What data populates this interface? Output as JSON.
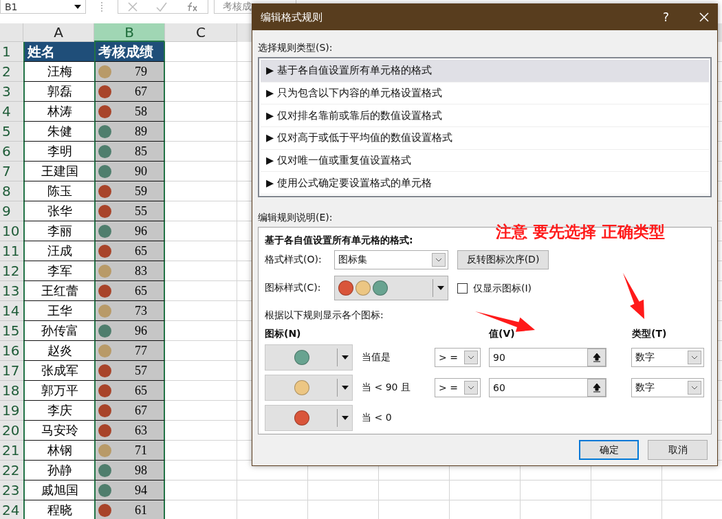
{
  "formula_bar": {
    "name_box": "B1",
    "formula": "考核成"
  },
  "columns": [
    {
      "label": "A",
      "selected": false
    },
    {
      "label": "B",
      "selected": true
    },
    {
      "label": "C",
      "selected": false
    }
  ],
  "header_row": {
    "row": "1",
    "cells": [
      "姓名",
      "考核成绩"
    ]
  },
  "rows": [
    {
      "row": "2",
      "name": "汪梅",
      "score": "79",
      "color": "#b89a68"
    },
    {
      "row": "3",
      "name": "郭磊",
      "score": "67",
      "color": "#a8442a"
    },
    {
      "row": "4",
      "name": "林涛",
      "score": "58",
      "color": "#a8442a"
    },
    {
      "row": "5",
      "name": "朱健",
      "score": "89",
      "color": "#4f7e6d"
    },
    {
      "row": "6",
      "name": "李明",
      "score": "85",
      "color": "#4f7e6d"
    },
    {
      "row": "7",
      "name": "王建国",
      "score": "90",
      "color": "#4f7e6d"
    },
    {
      "row": "8",
      "name": "陈玉",
      "score": "59",
      "color": "#a8442a"
    },
    {
      "row": "9",
      "name": "张华",
      "score": "55",
      "color": "#a8442a"
    },
    {
      "row": "10",
      "name": "李丽",
      "score": "96",
      "color": "#4f7e6d"
    },
    {
      "row": "11",
      "name": "汪成",
      "score": "65",
      "color": "#a8442a"
    },
    {
      "row": "12",
      "name": "李军",
      "score": "83",
      "color": "#b89a68"
    },
    {
      "row": "13",
      "name": "王红蕾",
      "score": "65",
      "color": "#a8442a"
    },
    {
      "row": "14",
      "name": "王华",
      "score": "73",
      "color": "#b89a68"
    },
    {
      "row": "15",
      "name": "孙传富",
      "score": "96",
      "color": "#4f7e6d"
    },
    {
      "row": "16",
      "name": "赵炎",
      "score": "77",
      "color": "#b89a68"
    },
    {
      "row": "17",
      "name": "张成军",
      "score": "57",
      "color": "#a8442a"
    },
    {
      "row": "18",
      "name": "郭万平",
      "score": "65",
      "color": "#a8442a"
    },
    {
      "row": "19",
      "name": "李庆",
      "score": "67",
      "color": "#a8442a"
    },
    {
      "row": "20",
      "name": "马安玲",
      "score": "63",
      "color": "#a8442a"
    },
    {
      "row": "21",
      "name": "林钢",
      "score": "71",
      "color": "#b89a68"
    },
    {
      "row": "22",
      "name": "孙静",
      "score": "98",
      "color": "#4f7e6d"
    },
    {
      "row": "23",
      "name": "戚旭国",
      "score": "94",
      "color": "#4f7e6d"
    },
    {
      "row": "24",
      "name": "程晓",
      "score": "61",
      "color": "#a8442a"
    }
  ],
  "dialog": {
    "title": "编辑格式规则",
    "help": "?",
    "rule_type_label": "选择规则类型(S):",
    "rule_types": [
      {
        "label": "▶ 基于各自值设置所有单元格的格式",
        "selected": true
      },
      {
        "label": "▶ 只为包含以下内容的单元格设置格式",
        "selected": false
      },
      {
        "label": "▶ 仅对排名靠前或靠后的数值设置格式",
        "selected": false
      },
      {
        "label": "▶ 仅对高于或低于平均值的数值设置格式",
        "selected": false
      },
      {
        "label": "▶ 仅对唯一值或重复值设置格式",
        "selected": false
      },
      {
        "label": "▶ 使用公式确定要设置格式的单元格",
        "selected": false
      }
    ],
    "description_label": "编辑规则说明(E):",
    "description": {
      "heading": "基于各自值设置所有单元格的格式:",
      "format_style": {
        "label": "格式样式(O):",
        "value": "图标集"
      },
      "reverse_button": "反转图标次序(D)",
      "icon_style": {
        "label": "图标样式(C):",
        "colors": [
          {
            "color": "#d9553a"
          },
          {
            "color": "#ecc683"
          },
          {
            "color": "#68a390"
          }
        ]
      },
      "show_icon_only": {
        "label": "仅显示图标(I)",
        "checked": false
      },
      "rules_label": "根据以下规则显示各个图标:",
      "headers": {
        "icon": "图标(N)",
        "value": "值(V)",
        "type": "类型(T)"
      },
      "rules": [
        {
          "kind": "threshold",
          "color": "#68a390",
          "condition": "当值是",
          "operator": "> =",
          "value": "90",
          "type": "数字"
        },
        {
          "kind": "threshold",
          "color": "#ecc683",
          "condition": "当 < 90 且",
          "operator": "> =",
          "value": "60",
          "type": "数字"
        },
        {
          "kind": "last",
          "color": "#d9553a",
          "condition": "当 < 0"
        }
      ]
    },
    "buttons": [
      {
        "label": "确定",
        "default": true
      },
      {
        "label": "取消",
        "default": false
      }
    ]
  },
  "annotation": "注意 要先选择 正确类型"
}
